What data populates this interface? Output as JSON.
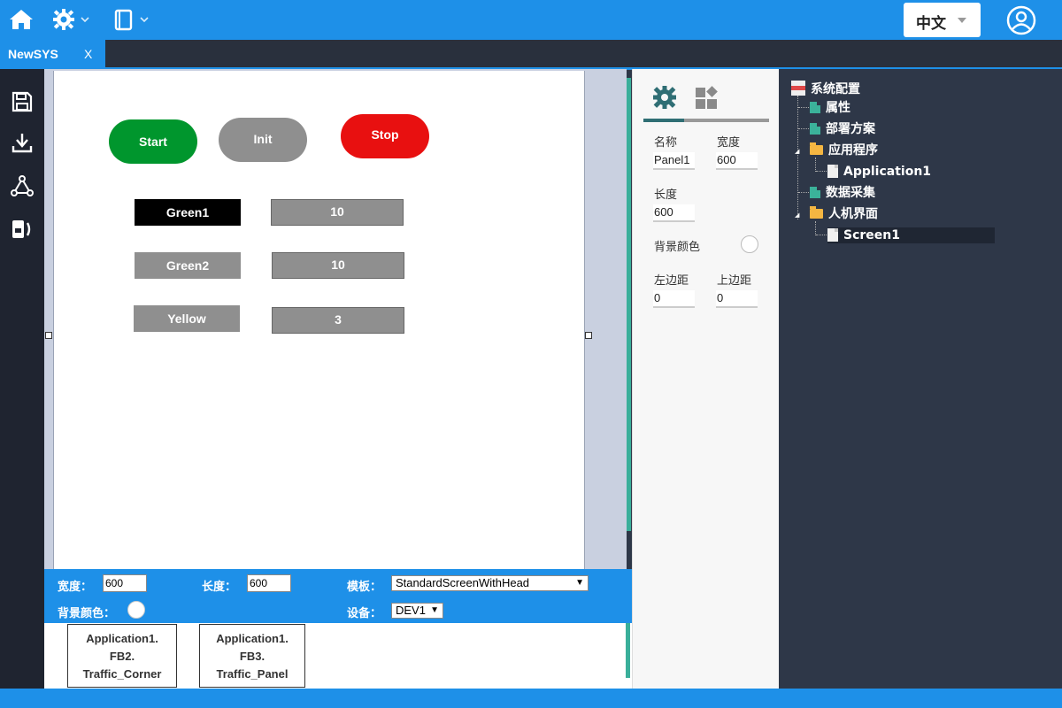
{
  "colors": {
    "accent": "#1e90e8",
    "start": "#00962d",
    "init": "#8f8f8f",
    "stop": "#e81010",
    "teal": "#3aaf9a"
  },
  "topbar": {
    "icons": [
      "home-icon",
      "gear-icon",
      "book-icon",
      "user-icon"
    ],
    "language": "中文"
  },
  "tabs": [
    {
      "label": "NewSYS",
      "close": "X"
    }
  ],
  "left_toolbar": [
    "save-icon",
    "download-icon",
    "network-icon",
    "device-icon"
  ],
  "canvas": {
    "buttons": {
      "start": "Start",
      "init": "Init",
      "stop": "Stop"
    },
    "rows": [
      {
        "label": "Green1",
        "value": "10"
      },
      {
        "label": "Green2",
        "value": "10"
      },
      {
        "label": "Yellow",
        "value": "3"
      }
    ]
  },
  "bottom_props": {
    "width_label": "宽度：",
    "width_value": "600",
    "length_label": "长度：",
    "length_value": "600",
    "template_label": "模板：",
    "template_value": "StandardScreenWithHead",
    "bg_label": "背景颜色：",
    "device_label": "设备：",
    "device_value": "DEV1"
  },
  "function_blocks": [
    {
      "line1": "Application1.",
      "line2": "FB2.",
      "line3": "Traffic_Corner"
    },
    {
      "line1": "Application1.",
      "line2": "FB3.",
      "line3": "Traffic_Panel"
    }
  ],
  "properties": {
    "name_label": "名称",
    "name_value": "Panel1",
    "width_label": "宽度",
    "width_value": "600",
    "length_label": "长度",
    "length_value": "600",
    "bg_label": "背景颜色",
    "left_label": "左边距",
    "left_value": "0",
    "top_label": "上边距",
    "top_value": "0"
  },
  "tree": {
    "root": "系统配置",
    "attributes": "属性",
    "deployment": "部署方案",
    "applications": "应用程序",
    "application1": "Application1",
    "data_collection": "数据采集",
    "hmi": "人机界面",
    "screen1": "Screen1"
  }
}
